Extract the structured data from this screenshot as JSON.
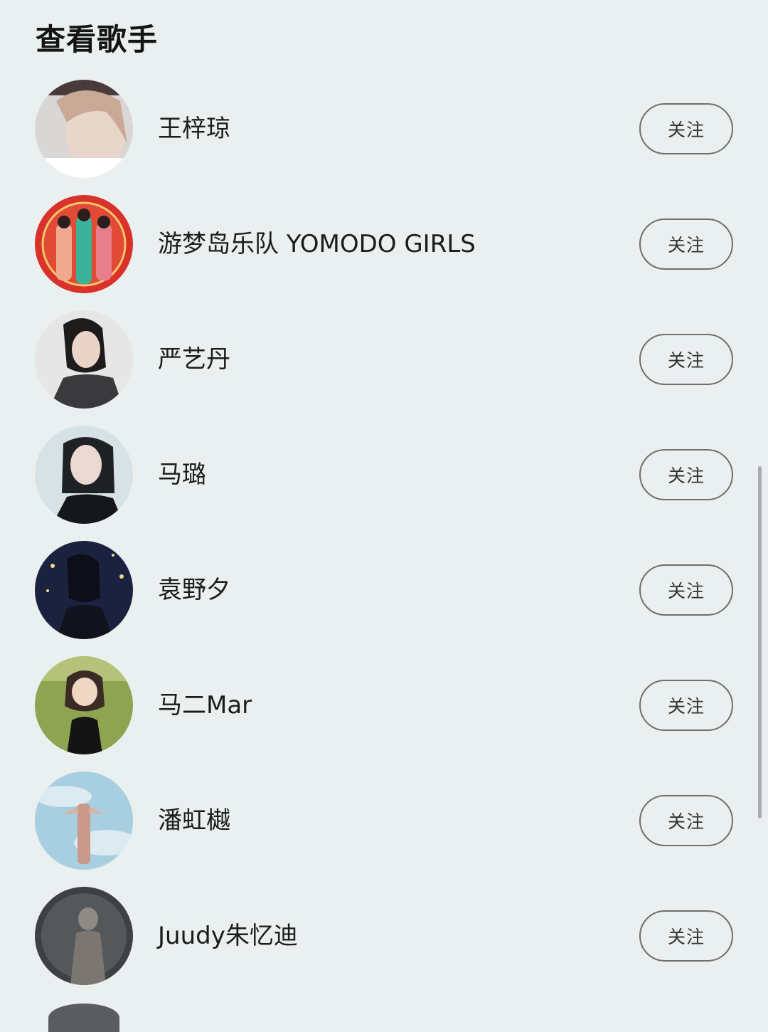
{
  "header": {
    "title": "查看歌手"
  },
  "artists": [
    {
      "name": "王梓琼",
      "follow_label": "关注"
    },
    {
      "name": "游梦岛乐队 YOMODO GIRLS",
      "follow_label": "关注"
    },
    {
      "name": "严艺丹",
      "follow_label": "关注"
    },
    {
      "name": "马璐",
      "follow_label": "关注"
    },
    {
      "name": "袁野夕",
      "follow_label": "关注"
    },
    {
      "name": "马二Mar",
      "follow_label": "关注"
    },
    {
      "name": "潘虹樾",
      "follow_label": "关注"
    },
    {
      "name": "Juudy朱忆迪",
      "follow_label": "关注"
    }
  ],
  "colors": {
    "background": "#eaeff0",
    "button_border": "#6f6f6f",
    "text": "#1c1c1c"
  }
}
